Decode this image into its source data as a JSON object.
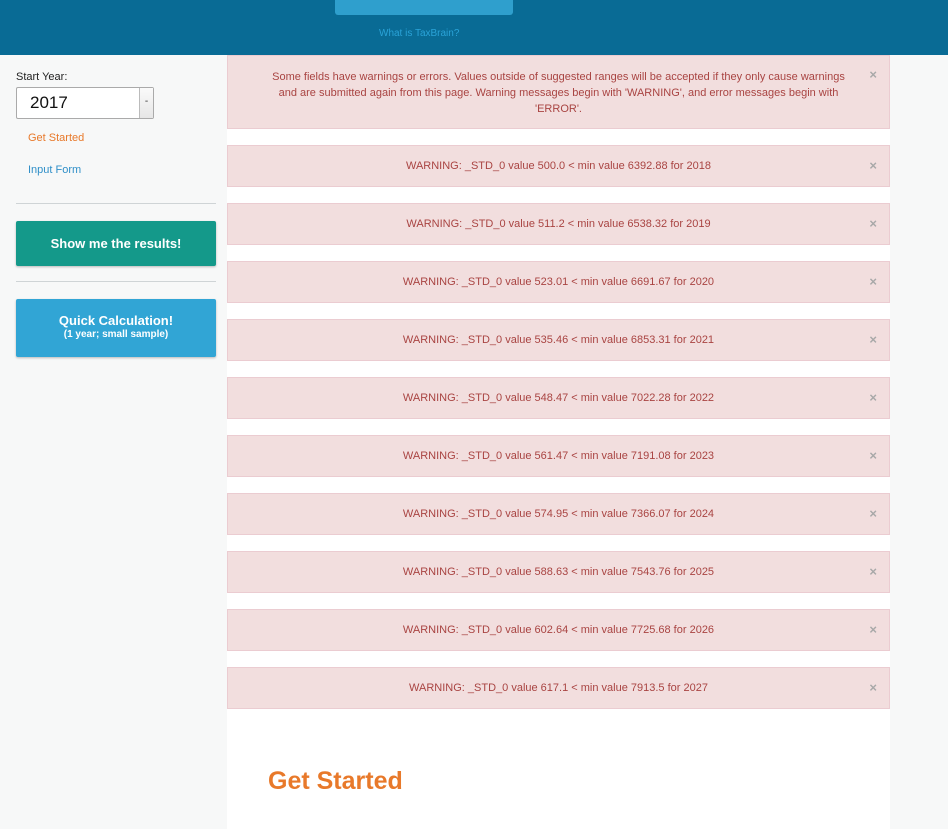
{
  "header": {
    "link_text": "What is TaxBrain?"
  },
  "sidebar": {
    "start_year_label": "Start Year:",
    "start_year_value": "2017",
    "select_arrow": "-",
    "nav": {
      "get_started": "Get Started",
      "input_form": "Input Form"
    },
    "results_button": "Show me the results!",
    "quick_button": {
      "line1": "Quick Calculation!",
      "line2": "(1 year; small sample)"
    }
  },
  "alerts": {
    "close_symbol": "×",
    "intro": "Some fields have warnings or errors. Values outside of suggested ranges will be accepted if they only cause warnings and are submitted again from this page. Warning messages begin with 'WARNING', and error messages begin with 'ERROR'.",
    "warnings": [
      "WARNING: _STD_0 value 500.0 < min value 6392.88 for 2018",
      "WARNING: _STD_0 value 511.2 < min value 6538.32 for 2019",
      "WARNING: _STD_0 value 523.01 < min value 6691.67 for 2020",
      "WARNING: _STD_0 value 535.46 < min value 6853.31 for 2021",
      "WARNING: _STD_0 value 548.47 < min value 7022.28 for 2022",
      "WARNING: _STD_0 value 561.47 < min value 7191.08 for 2023",
      "WARNING: _STD_0 value 574.95 < min value 7366.07 for 2024",
      "WARNING: _STD_0 value 588.63 < min value 7543.76 for 2025",
      "WARNING: _STD_0 value 602.64 < min value 7725.68 for 2026",
      "WARNING: _STD_0 value 617.1 < min value 7913.5 for 2027"
    ]
  },
  "main": {
    "section_title": "Get Started"
  },
  "colors": {
    "header_bg": "#096b95",
    "accent_orange": "#e8792a",
    "link_blue": "#2f8fc8",
    "results_button": "#14998a",
    "quick_button": "#31a5d5",
    "alert_bg": "#f2dede",
    "alert_text": "#a94442"
  }
}
